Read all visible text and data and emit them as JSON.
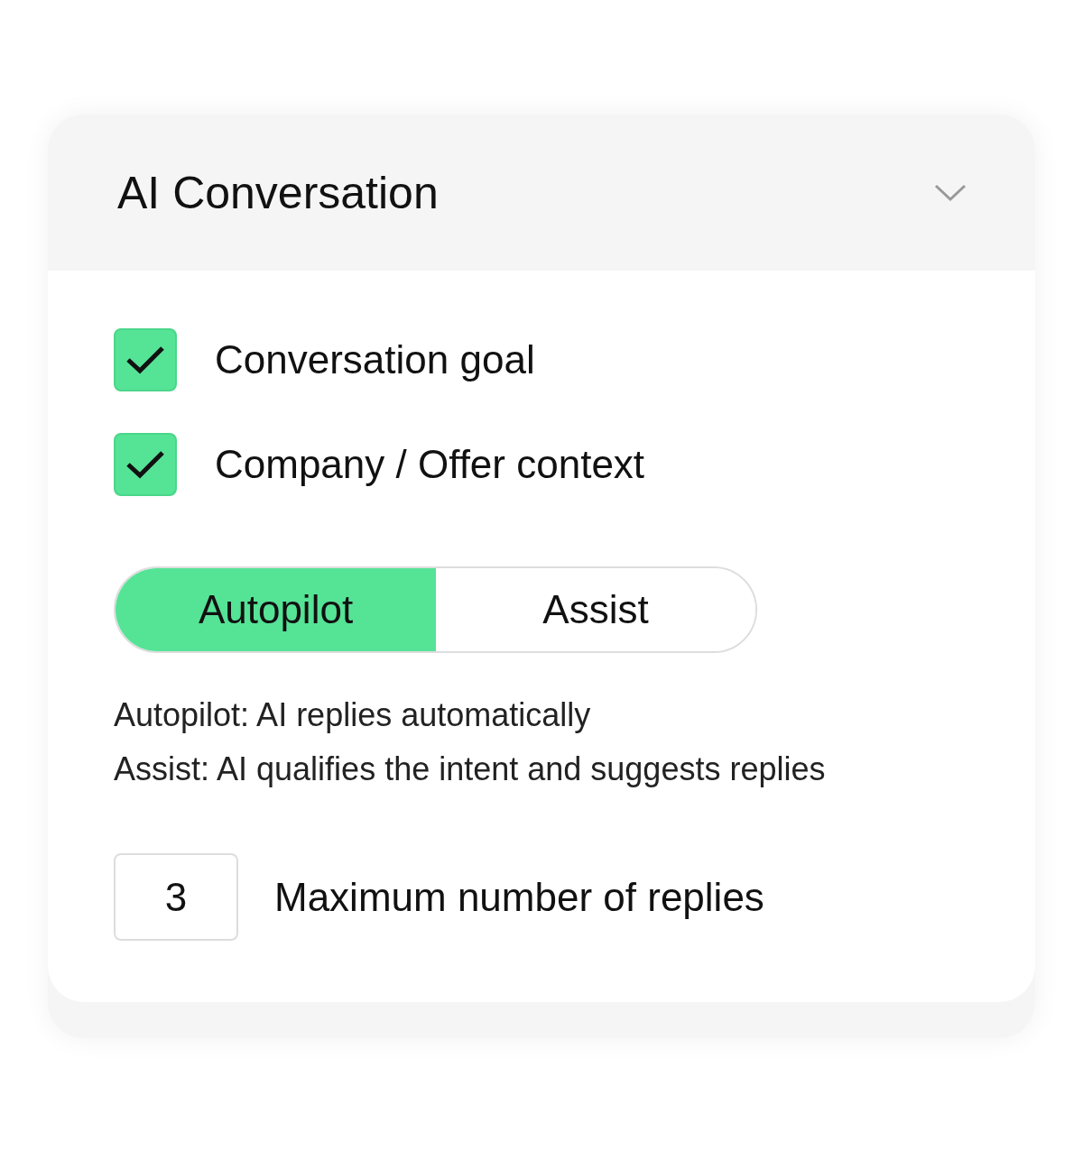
{
  "panel": {
    "title": "AI Conversation",
    "expanded": true
  },
  "options": [
    {
      "label": "Conversation goal",
      "checked": true
    },
    {
      "label": "Company / Offer context",
      "checked": true
    }
  ],
  "mode_switch": [
    {
      "label": "Autopilot",
      "selected": true
    },
    {
      "label": "Assist",
      "selected": false
    }
  ],
  "descriptions": [
    "Autopilot: AI replies automatically",
    "Assist: AI qualifies the intent and suggests replies"
  ],
  "max_replies": {
    "value": "3",
    "label": "Maximum number of replies"
  }
}
